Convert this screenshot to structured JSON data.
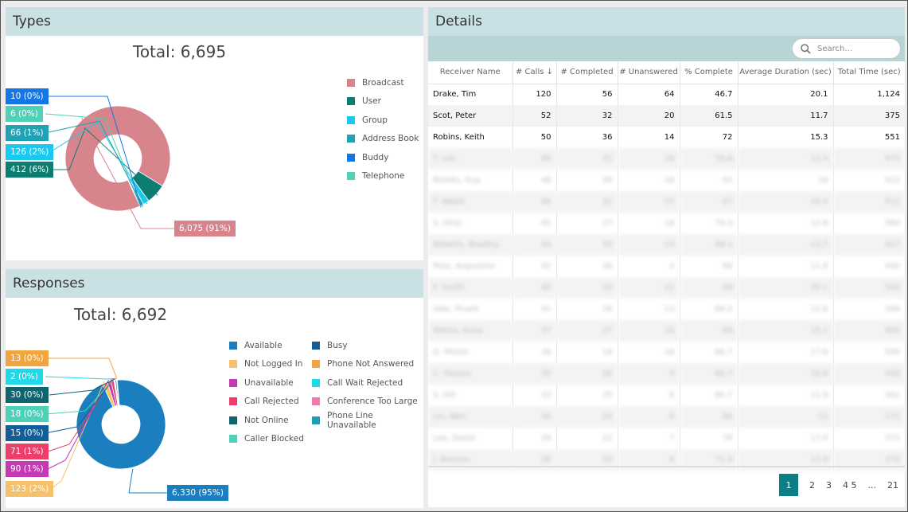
{
  "types": {
    "title": "Types",
    "total": "Total: 6,695",
    "legend": [
      {
        "label": "Broadcast",
        "color": "#d8848c"
      },
      {
        "label": "User",
        "color": "#0d7d71"
      },
      {
        "label": "Group",
        "color": "#1ac9ef"
      },
      {
        "label": "Address Book",
        "color": "#1fa2b3"
      },
      {
        "label": "Buddy",
        "color": "#1576e8"
      },
      {
        "label": "Telephone",
        "color": "#4fd1b7"
      }
    ],
    "slices": [
      {
        "label": "6,075 (91%)",
        "value": 6075,
        "color": "#d8848c"
      },
      {
        "label": "412 (6%)",
        "value": 412,
        "color": "#0d7d71"
      },
      {
        "label": "126 (2%)",
        "value": 126,
        "color": "#1ac9ef"
      },
      {
        "label": "66 (1%)",
        "value": 66,
        "color": "#1fa2b3"
      },
      {
        "label": "10 (0%)",
        "value": 10,
        "color": "#1576e8"
      },
      {
        "label": "6 (0%)",
        "value": 6,
        "color": "#4fd1b7"
      }
    ]
  },
  "responses": {
    "title": "Responses",
    "total": "Total: 6,692",
    "legend": [
      {
        "label": "Available",
        "color": "#1b7fbf"
      },
      {
        "label": "Busy",
        "color": "#135e99"
      },
      {
        "label": "Not Logged In",
        "color": "#f5c16c"
      },
      {
        "label": "Phone Not Answered",
        "color": "#f1a53e"
      },
      {
        "label": "Unavailable",
        "color": "#c43ab3"
      },
      {
        "label": "Call Wait Rejected",
        "color": "#1fd8e8"
      },
      {
        "label": "Call Rejected",
        "color": "#ee3d6b"
      },
      {
        "label": "Conference Too Large",
        "color": "#f07aa9"
      },
      {
        "label": "Not Online",
        "color": "#0f6470"
      },
      {
        "label": "Phone Line Unavailable",
        "color": "#1b9fb7"
      },
      {
        "label": "Caller Blocked",
        "color": "#4fd1b7"
      }
    ],
    "slices": [
      {
        "label": "6,330 (95%)",
        "value": 6330,
        "color": "#1b7fbf"
      },
      {
        "label": "123 (2%)",
        "value": 123,
        "color": "#f5c16c"
      },
      {
        "label": "90 (1%)",
        "value": 90,
        "color": "#c43ab3"
      },
      {
        "label": "71 (1%)",
        "value": 71,
        "color": "#ee3d6b"
      },
      {
        "label": "15 (0%)",
        "value": 15,
        "color": "#135e99"
      },
      {
        "label": "18 (0%)",
        "value": 18,
        "color": "#4fd1b7"
      },
      {
        "label": "30 (0%)",
        "value": 30,
        "color": "#0f6470"
      },
      {
        "label": "2 (0%)",
        "value": 2,
        "color": "#1fd8e8"
      },
      {
        "label": "13 (0%)",
        "value": 13,
        "color": "#f1a53e"
      }
    ]
  },
  "details": {
    "title": "Details",
    "search_placeholder": "Search...",
    "columns": [
      "Receiver Name",
      "# Calls ↓",
      "# Completed",
      "# Unanswered",
      "% Complete",
      "Average Duration (sec)",
      "Total Time (sec)"
    ],
    "rows": [
      [
        "Drake, Tim",
        "120",
        "56",
        "64",
        "46.7",
        "20.1",
        "1,124"
      ],
      [
        "Scot, Peter",
        "52",
        "32",
        "20",
        "61.5",
        "11.7",
        "375"
      ],
      [
        "Robins, Keith",
        "50",
        "36",
        "14",
        "72",
        "15.3",
        "551"
      ]
    ],
    "blurred_rows": [
      [
        "T. Lee",
        "49",
        "31",
        "18",
        "70.6",
        "12.4",
        "470"
      ],
      [
        "Brooks, Guy",
        "48",
        "30",
        "18",
        "62",
        "18",
        "512"
      ],
      [
        "T. Walsh",
        "46",
        "31",
        "15",
        "67",
        "20.4",
        "511"
      ],
      [
        "S. Hirst",
        "45",
        "27",
        "18",
        "70.4",
        "12.6",
        "580"
      ],
      [
        "Roberts, Bradley",
        "44",
        "30",
        "14",
        "68.1",
        "13.7",
        "427"
      ],
      [
        "Pete, Augustine",
        "42",
        "38",
        "4",
        "90",
        "11.8",
        "440"
      ],
      [
        "P. Smith",
        "40",
        "19",
        "21",
        "48",
        "20.1",
        "500"
      ],
      [
        "Vale, Pruett",
        "41",
        "28",
        "13",
        "68.2",
        "11.6",
        "390"
      ],
      [
        "Mehta, Anna",
        "37",
        "27",
        "10",
        "69",
        "15.1",
        "406"
      ],
      [
        "G. Moore",
        "36",
        "18",
        "18",
        "66.7",
        "17.6",
        "550"
      ],
      [
        "C. Haines",
        "35",
        "26",
        "9",
        "66.7",
        "18.8",
        "450"
      ],
      [
        "S. Hill",
        "33",
        "25",
        "8",
        "85.7",
        "11.9",
        "301"
      ],
      [
        "Lin, Wen",
        "30",
        "24",
        "6",
        "80",
        "12",
        "171"
      ],
      [
        "Lee, David",
        "29",
        "22",
        "7",
        "76",
        "17.6",
        "372"
      ],
      [
        "J. Benson",
        "28",
        "20",
        "8",
        "71.4",
        "13.8",
        "376"
      ]
    ],
    "pagination": {
      "current": "1",
      "pages": [
        "2",
        "3",
        "4 5",
        "...",
        "21"
      ]
    }
  }
}
